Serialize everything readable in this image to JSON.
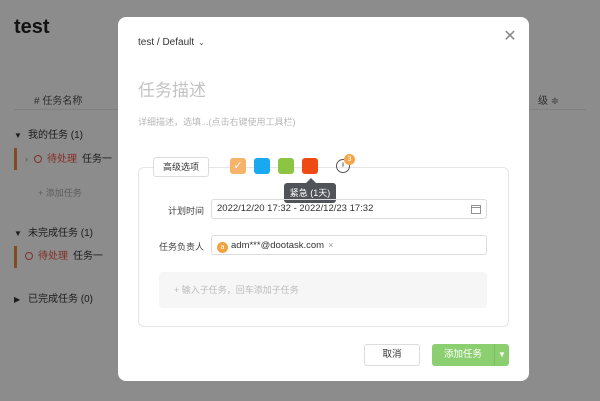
{
  "background": {
    "title": "test",
    "columns": {
      "name": "# 任务名称",
      "right": "级 ≑"
    },
    "groups": [
      {
        "label": "我的任务 (1)"
      },
      {
        "label": "未完成任务 (1)"
      },
      {
        "label": "已完成任务 (0)"
      }
    ],
    "tasks": [
      {
        "tag": "待处理",
        "name": "任务一"
      },
      {
        "tag": "待处理",
        "name": "任务一"
      }
    ],
    "add_task": "+ 添加任务"
  },
  "modal": {
    "breadcrumb": "test / Default",
    "title_placeholder": "任务描述",
    "desc_placeholder": "详细描述，选填...(点击右键使用工具栏)",
    "advanced_label": "高级选项",
    "priority_colors": [
      "#f7b36a",
      "#18a9ef",
      "#8cc543",
      "#f04a14"
    ],
    "badge_count": "3",
    "tooltip": "紧急 (1天)",
    "plan_time_label": "计划时间",
    "plan_time_value": "2022/12/20 17:32 - 2022/12/23 17:32",
    "owner_label": "任务负责人",
    "owner_avatar": "a",
    "owner_email": "adm***@dootask.com",
    "subtask_placeholder": "+ 输入子任务，回车添加子任务",
    "cancel_label": "取消",
    "submit_label": "添加任务"
  }
}
